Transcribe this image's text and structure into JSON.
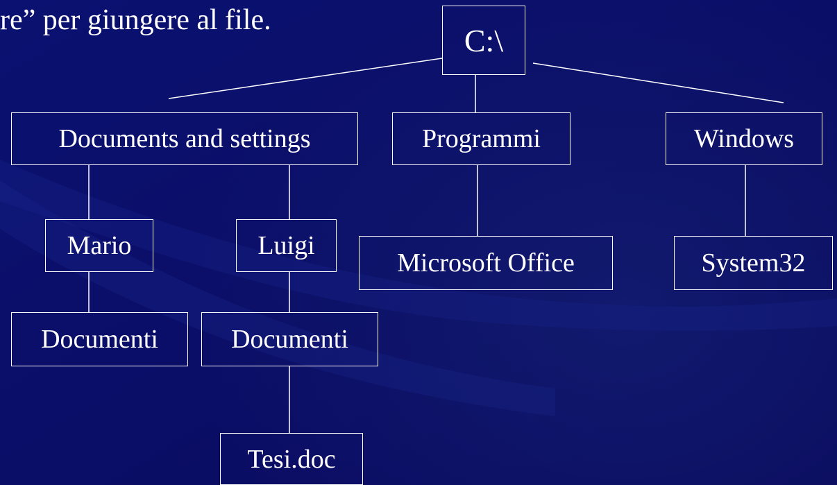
{
  "slide": {
    "heading_fragment": "re” per giungere al file."
  },
  "tree": {
    "root": "C:\\",
    "level1": {
      "documents_and_settings": "Documents and settings",
      "programmi": "Programmi",
      "windows": "Windows"
    },
    "level2": {
      "mario": "Mario",
      "luigi": "Luigi",
      "microsoft_office": "Microsoft Office",
      "system32": "System32"
    },
    "level3": {
      "mario_documenti": "Documenti",
      "luigi_documenti": "Documenti"
    },
    "level4": {
      "tesi": "Tesi.doc"
    }
  }
}
